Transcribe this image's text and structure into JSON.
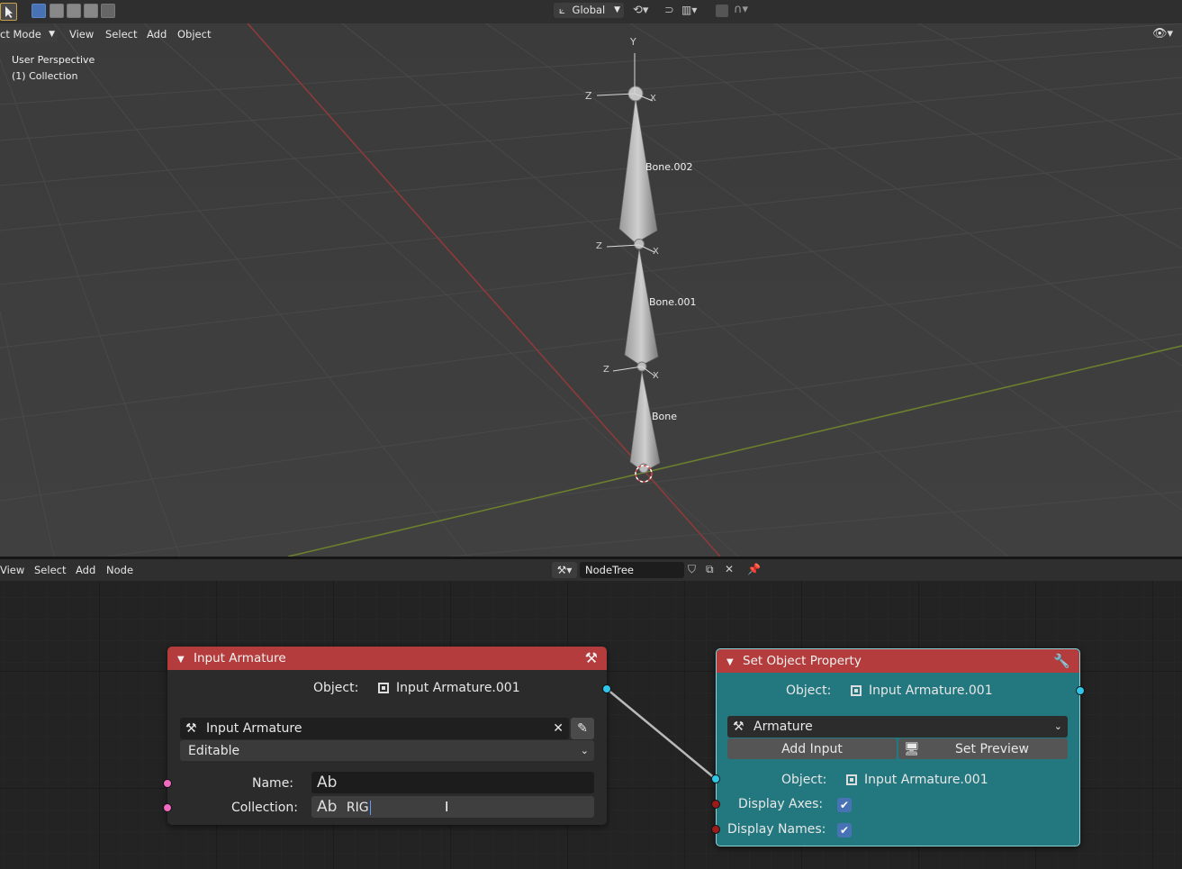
{
  "menu3d": {
    "mode": "ct Mode",
    "view": "View",
    "select": "Select",
    "add": "Add",
    "object": "Object"
  },
  "transform_orientation": "Global",
  "viewport": {
    "perspective": "User Perspective",
    "collection": "(1) Collection"
  },
  "bones": [
    {
      "name": "Bone.002"
    },
    {
      "name": "Bone.001"
    },
    {
      "name": "Bone"
    }
  ],
  "axis_labels": {
    "x": "X",
    "y": "Y",
    "z": "Z"
  },
  "node_menu": {
    "view": "View",
    "select": "Select",
    "add": "Add",
    "node": "Node"
  },
  "node_tree": {
    "name": "NodeTree"
  },
  "nodes": {
    "input_armature": {
      "title": "Input Armature",
      "object_label": "Object:",
      "object_value": "Input Armature.001",
      "selector_value": "Input Armature",
      "mode_value": "Editable",
      "name_label": "Name:",
      "name_value": "",
      "collection_label": "Collection:",
      "collection_value": "RIG",
      "text_icon_glyph": "Ab"
    },
    "set_object_property": {
      "title": "Set Object Property",
      "object_label": "Object:",
      "object_value": "Input Armature.001",
      "type_value": "Armature",
      "add_input_label": "Add Input",
      "set_preview_label": "Set Preview",
      "object2_label": "Object:",
      "object2_value": "Input Armature.001",
      "display_axes_label": "Display Axes:",
      "display_axes_checked": true,
      "display_names_label": "Display Names:",
      "display_names_checked": true
    }
  },
  "colors": {
    "node_header_red": "#b43c3c",
    "node_body_dark": "#2b2b2b",
    "node_body_teal": "#23777f",
    "socket_cyan": "#2fc6e8",
    "socket_pink": "#f06ac0",
    "socket_red": "#9b1b1b",
    "accent_blue": "#4772b3"
  }
}
